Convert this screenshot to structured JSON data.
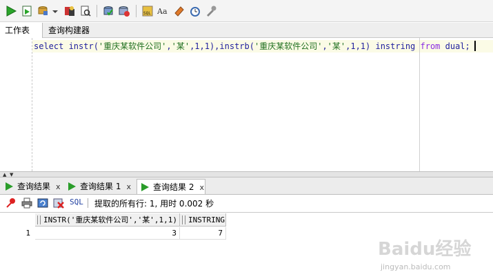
{
  "toolbar": {
    "icons": [
      "run-statement-icon",
      "run-script-icon",
      "commit-icon",
      "dropdown-arrow-icon",
      "explain-plan-icon",
      "autotrace-icon",
      "sql-tuning-icon",
      "clear-icon",
      "sql-history-icon",
      "format-icon",
      "uppercase-icon",
      "eraser-icon",
      "find-icon",
      "tools-icon"
    ]
  },
  "editor_tabs": [
    {
      "label": "工作表",
      "active": true
    },
    {
      "label": "查询构建器",
      "active": false
    }
  ],
  "editor": {
    "tokens": [
      {
        "t": "select instr(",
        "c": "kw"
      },
      {
        "t": "'重庆某软件公司'",
        "c": "str"
      },
      {
        "t": ",",
        "c": "kw"
      },
      {
        "t": "'某'",
        "c": "str"
      },
      {
        "t": ",1,1),instrb(",
        "c": "kw"
      },
      {
        "t": "'重庆某软件公司'",
        "c": "str"
      },
      {
        "t": ",",
        "c": "kw"
      },
      {
        "t": "'某'",
        "c": "str"
      },
      {
        "t": ",1,1) instring ",
        "c": "kw"
      },
      {
        "t": "from",
        "c": "from"
      },
      {
        "t": " dual;",
        "c": "kw"
      }
    ]
  },
  "result_tabs": [
    {
      "label": "查询结果",
      "close": "x",
      "active": false
    },
    {
      "label": "查询结果 1",
      "close": "x",
      "active": false
    },
    {
      "label": "查询结果 2",
      "close": "x",
      "active": true
    }
  ],
  "results_toolbar": {
    "sql_label": "SQL",
    "status": "提取的所有行: 1, 用时 0.002 秒"
  },
  "grid": {
    "columns": [
      "INSTR('重庆某软件公司','某',1,1)",
      "INSTRING"
    ],
    "rows": [
      {
        "num": "1",
        "cells": [
          "3",
          "7"
        ]
      }
    ]
  },
  "watermark": {
    "logo": "Baidu经验",
    "url": "jingyan.baidu.com"
  }
}
